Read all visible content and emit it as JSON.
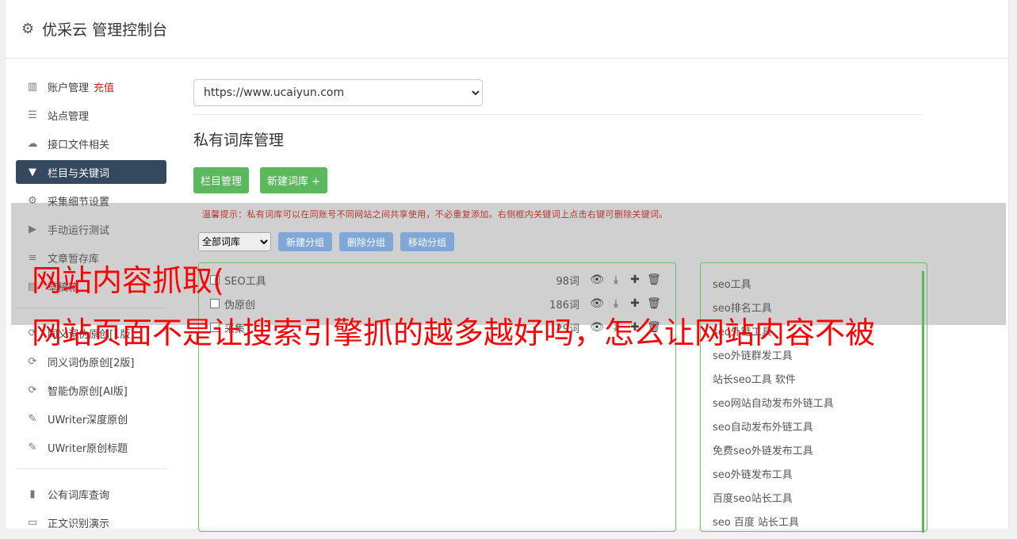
{
  "header": {
    "title": "优采云 管理控制台"
  },
  "sidebar": {
    "items": [
      {
        "label": "账户管理",
        "badge": "充值",
        "icon": "bar-chart-icon"
      },
      {
        "label": "站点管理",
        "icon": "server-icon"
      },
      {
        "label": "接口文件相关",
        "icon": "cloud-upload-icon"
      },
      {
        "label": "栏目与关键词",
        "icon": "filter-icon",
        "active": true
      },
      {
        "label": "采集细节设置",
        "icon": "cogs-icon"
      },
      {
        "label": "手动运行测试",
        "icon": "play-circle-icon"
      },
      {
        "label": "文章暂存库",
        "icon": "database-icon"
      },
      {
        "label": "草稿箱",
        "icon": "list-icon"
      }
    ],
    "items2": [
      {
        "label": "同义词伪原创[1版]",
        "icon": "refresh-icon"
      },
      {
        "label": "同义词伪原创[2版]",
        "icon": "refresh-icon"
      },
      {
        "label": "智能伪原创[AI版]",
        "icon": "refresh-icon"
      },
      {
        "label": "UWriter深度原创",
        "icon": "edit-icon"
      },
      {
        "label": "UWriter原创标题",
        "icon": "edit-icon"
      }
    ],
    "items3": [
      {
        "label": "公有词库查询",
        "icon": "book-icon"
      },
      {
        "label": "正文识别演示",
        "icon": "desktop-icon"
      }
    ]
  },
  "main": {
    "site": "https://www.ucaiyun.com",
    "title": "私有词库管理",
    "btn_columns": "栏目管理",
    "btn_new": "新建词库 +",
    "tip": "温馨提示：私有词库可以在同账号不同网站之间共享使用，不必重复添加。右侧框内关键词上点击右键可删除关键词。",
    "filter_value": "全部词库",
    "btn_new_group": "新建分组",
    "btn_delete_group": "删除分组",
    "btn_move_group": "移动分组",
    "groups": [
      {
        "name": "SEO工具",
        "count": "98词"
      },
      {
        "name": "伪原创",
        "count": "186词"
      },
      {
        "name": "采集",
        "count": "29词"
      }
    ],
    "keywords": [
      "seo工具",
      "seo排名工具",
      "seo外链工具",
      "seo外链群发工具",
      "站长seo工具 软件",
      "seo网站自动发布外链工具",
      "seo自动发布外链工具",
      "免费seo外链发布工具",
      "seo外链发布工具",
      "百度seo站长工具",
      "seo 百度 站长工具"
    ]
  },
  "watermark": {
    "line1": "网站内容抓取(",
    "line2": "网站页面不是让搜索引擎抓的越多越好吗，怎么让网站内容不被"
  }
}
